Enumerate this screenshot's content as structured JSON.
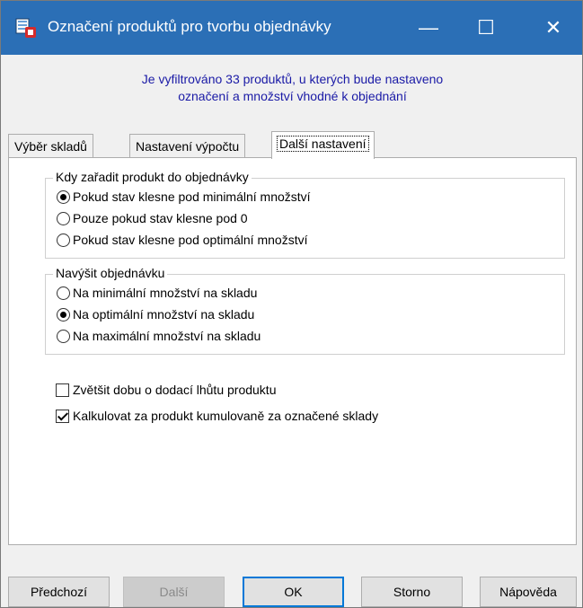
{
  "window": {
    "title": "Označení produktů pro tvorbu objednávky",
    "minimize_glyph": "—",
    "maximize_glyph": "☐",
    "close_glyph": "✕",
    "titlebar_color": "#2b6fb6"
  },
  "info": {
    "line1": "Je vyfiltrováno 33 produktů, u kterých bude nastaveno",
    "line2": "označení a množství vhodné k objednání"
  },
  "tabs": [
    {
      "label": "Výběr skladů",
      "active": false
    },
    {
      "label": "Nastavení výpočtu",
      "active": false
    },
    {
      "label": "Další nastavení",
      "active": true
    }
  ],
  "group1": {
    "title": "Kdy zařadit produkt do objednávky",
    "options": [
      {
        "label": "Pokud stav klesne pod minimální množství",
        "checked": true
      },
      {
        "label": "Pouze pokud stav klesne pod 0",
        "checked": false
      },
      {
        "label": "Pokud stav klesne pod optimální množství",
        "checked": false
      }
    ]
  },
  "group2": {
    "title": "Navýšit objednávku",
    "options": [
      {
        "label": "Na minimální množství na skladu",
        "checked": false
      },
      {
        "label": "Na optimální množství na skladu",
        "checked": true
      },
      {
        "label": "Na maximální množství na skladu",
        "checked": false
      }
    ]
  },
  "checkboxes": [
    {
      "label": "Zvětšit dobu o dodací lhůtu produktu",
      "checked": false
    },
    {
      "label": "Kalkulovat za produkt kumulovaně za označené sklady",
      "checked": true
    }
  ],
  "buttons": {
    "prev": "Předchozí",
    "next": "Další",
    "ok": "OK",
    "cancel": "Storno",
    "help": "Nápověda"
  }
}
